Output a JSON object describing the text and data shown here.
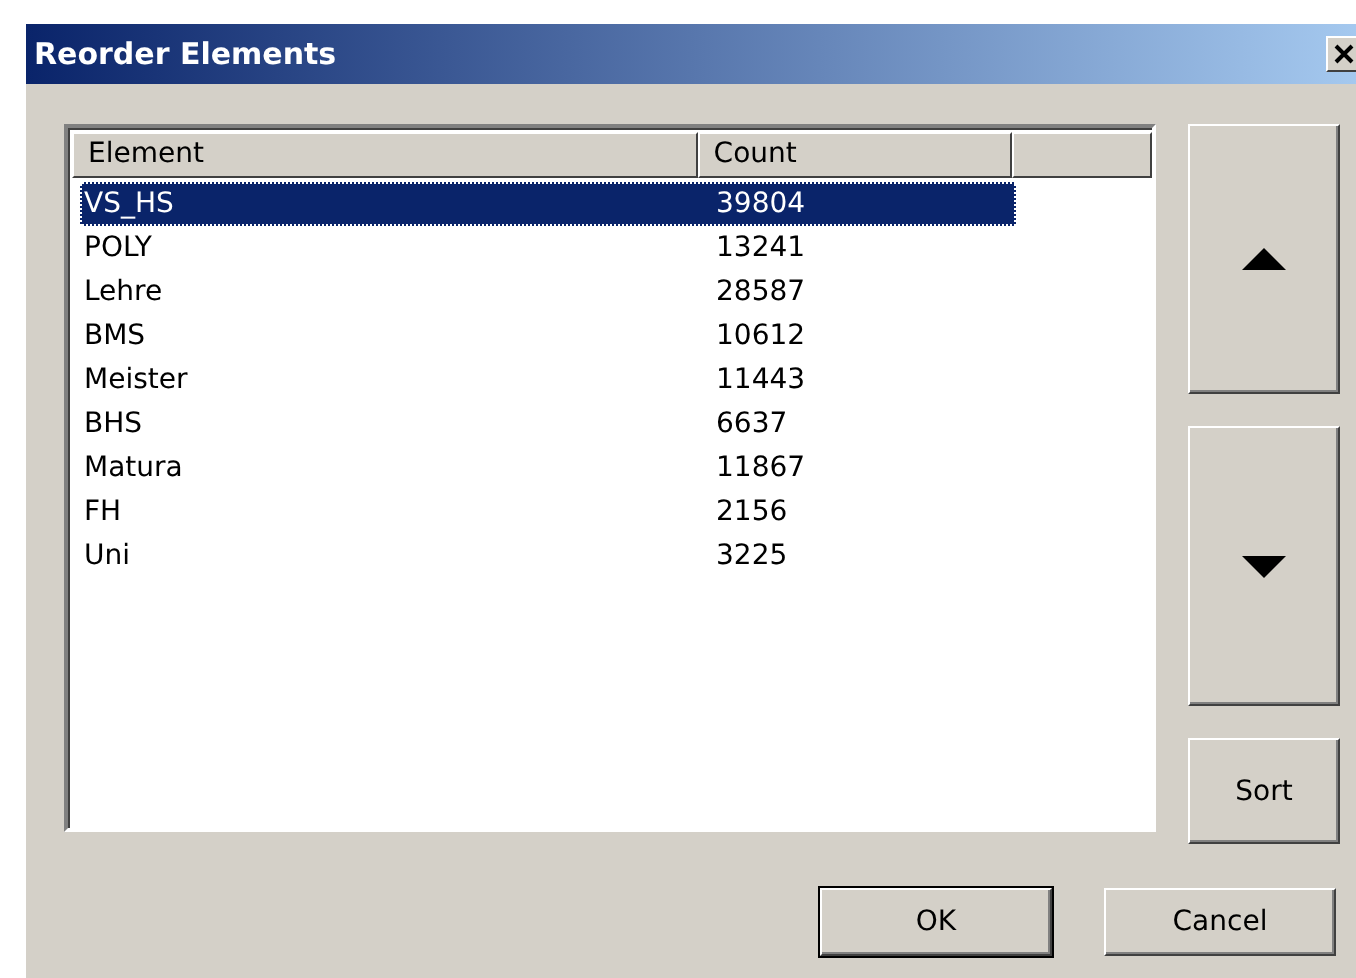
{
  "window": {
    "title": "Reorder Elements"
  },
  "list": {
    "columns": [
      "Element",
      "Count"
    ],
    "rows": [
      {
        "element": "VS_HS",
        "count": "39804",
        "selected": true
      },
      {
        "element": "POLY",
        "count": "13241",
        "selected": false
      },
      {
        "element": "Lehre",
        "count": "28587",
        "selected": false
      },
      {
        "element": "BMS",
        "count": "10612",
        "selected": false
      },
      {
        "element": "Meister",
        "count": "11443",
        "selected": false
      },
      {
        "element": "BHS",
        "count": "6637",
        "selected": false
      },
      {
        "element": "Matura",
        "count": "11867",
        "selected": false
      },
      {
        "element": "FH",
        "count": "2156",
        "selected": false
      },
      {
        "element": "Uni",
        "count": "3225",
        "selected": false
      }
    ]
  },
  "side_buttons": [
    {
      "kind": "up"
    },
    {
      "kind": "down"
    },
    {
      "kind": "text",
      "label": "Sort"
    }
  ],
  "buttons": [
    {
      "label": "OK",
      "default": true
    },
    {
      "label": "Cancel",
      "default": false
    }
  ]
}
